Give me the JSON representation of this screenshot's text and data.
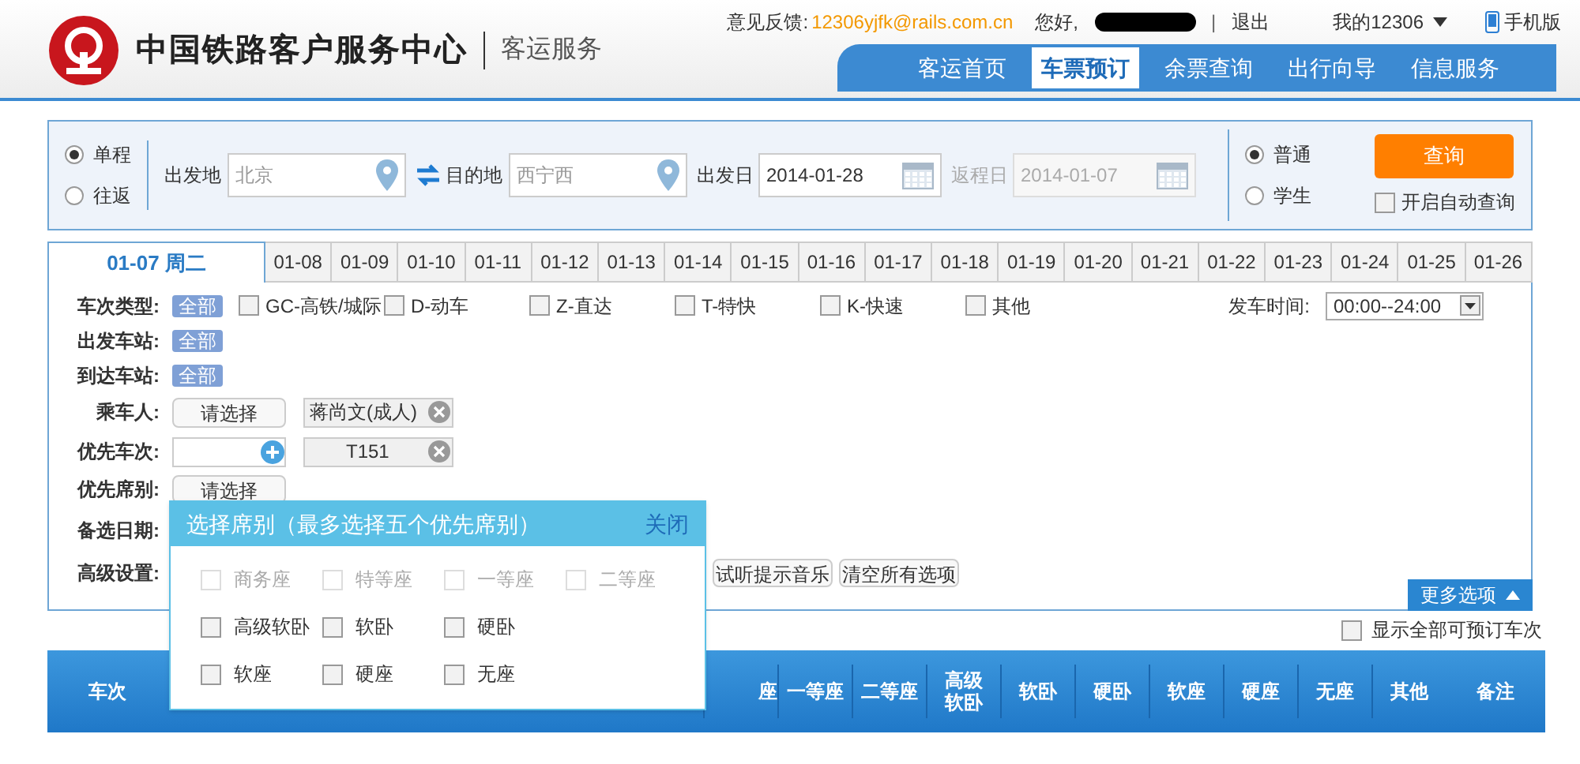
{
  "header": {
    "org": "中国铁路客户服务中心",
    "sub": "客运服务",
    "feedback_label": "意见反馈:",
    "feedback_email": "12306yjfk@rails.com.cn",
    "greeting": "您好,",
    "separator": "|",
    "logout": "退出",
    "my": "我的12306",
    "mobile": "手机版"
  },
  "nav": [
    {
      "label": "客运首页",
      "selected": false
    },
    {
      "label": "车票预订",
      "selected": true
    },
    {
      "label": "余票查询",
      "selected": false
    },
    {
      "label": "出行向导",
      "selected": false
    },
    {
      "label": "信息服务",
      "selected": false
    }
  ],
  "search": {
    "trip_types": [
      {
        "label": "单程",
        "selected": true
      },
      {
        "label": "往返",
        "selected": false
      }
    ],
    "from_label": "出发地",
    "from_value": "北京",
    "to_label": "目的地",
    "to_value": "西宁西",
    "depart_label": "出发日",
    "depart_value": "2014-01-28",
    "return_label": "返程日",
    "return_value": "2014-01-07",
    "return_disabled": true,
    "ticket_types": [
      {
        "label": "普通",
        "selected": true
      },
      {
        "label": "学生",
        "selected": false
      }
    ],
    "query_button": "查询",
    "auto_query": {
      "label": "开启自动查询",
      "checked": false
    }
  },
  "date_tabs": [
    {
      "label": "01-07 周二",
      "selected": true
    },
    {
      "label": "01-08",
      "selected": false
    },
    {
      "label": "01-09",
      "selected": false
    },
    {
      "label": "01-10",
      "selected": false
    },
    {
      "label": "01-11",
      "selected": false
    },
    {
      "label": "01-12",
      "selected": false
    },
    {
      "label": "01-13",
      "selected": false
    },
    {
      "label": "01-14",
      "selected": false
    },
    {
      "label": "01-15",
      "selected": false
    },
    {
      "label": "01-16",
      "selected": false
    },
    {
      "label": "01-17",
      "selected": false
    },
    {
      "label": "01-18",
      "selected": false
    },
    {
      "label": "01-19",
      "selected": false
    },
    {
      "label": "01-20",
      "selected": false
    },
    {
      "label": "01-21",
      "selected": false
    },
    {
      "label": "01-22",
      "selected": false
    },
    {
      "label": "01-23",
      "selected": false
    },
    {
      "label": "01-24",
      "selected": false
    },
    {
      "label": "01-25",
      "selected": false
    },
    {
      "label": "01-26",
      "selected": false
    }
  ],
  "filters": {
    "train_type_label": "车次类型:",
    "all": "全部",
    "train_types": [
      {
        "label": "GC-高铁/城际",
        "checked": false
      },
      {
        "label": "D-动车",
        "checked": false
      },
      {
        "label": "Z-直达",
        "checked": false
      },
      {
        "label": "T-特快",
        "checked": false
      },
      {
        "label": "K-快速",
        "checked": false
      },
      {
        "label": "其他",
        "checked": false
      }
    ],
    "time_label": "发车时间:",
    "time_value": "00:00--24:00",
    "from_station_label": "出发车站:",
    "from_station_all": "全部",
    "to_station_label": "到达车站:",
    "to_station_all": "全部",
    "passenger_label": "乘车人:",
    "passenger_button": "请选择",
    "passenger_tag": "蒋尚文(成人)",
    "train_label": "优先车次:",
    "train_tag": "T151",
    "seat_label": "优先席别:",
    "seat_button": "请选择",
    "date_label": "备选日期:",
    "advanced_label": "高级设置:",
    "music_button": "试听提示音乐",
    "clear_button": "清空所有选项",
    "more": "更多选项"
  },
  "show_all": {
    "label": "显示全部可预订车次",
    "checked": false
  },
  "table_columns": [
    "车次",
    "座",
    "一等座",
    "二等座",
    "高级软卧",
    "软卧",
    "硬卧",
    "软座",
    "硬座",
    "无座",
    "其他",
    "备注"
  ],
  "seat_popup": {
    "title": "选择席别（最多选择五个优先席别）",
    "close": "关闭",
    "rows": [
      [
        {
          "label": "商务座",
          "checked": false,
          "disabled": true
        },
        {
          "label": "特等座",
          "checked": false,
          "disabled": true
        },
        {
          "label": "一等座",
          "checked": false,
          "disabled": true
        },
        {
          "label": "二等座",
          "checked": false,
          "disabled": true
        }
      ],
      [
        {
          "label": "高级软卧",
          "checked": false,
          "disabled": false
        },
        {
          "label": "软卧",
          "checked": false,
          "disabled": false
        },
        {
          "label": "硬卧",
          "checked": false,
          "disabled": false
        }
      ],
      [
        {
          "label": "软座",
          "checked": false,
          "disabled": false
        },
        {
          "label": "硬座",
          "checked": false,
          "disabled": false
        },
        {
          "label": "无座",
          "checked": false,
          "disabled": false
        }
      ]
    ]
  }
}
